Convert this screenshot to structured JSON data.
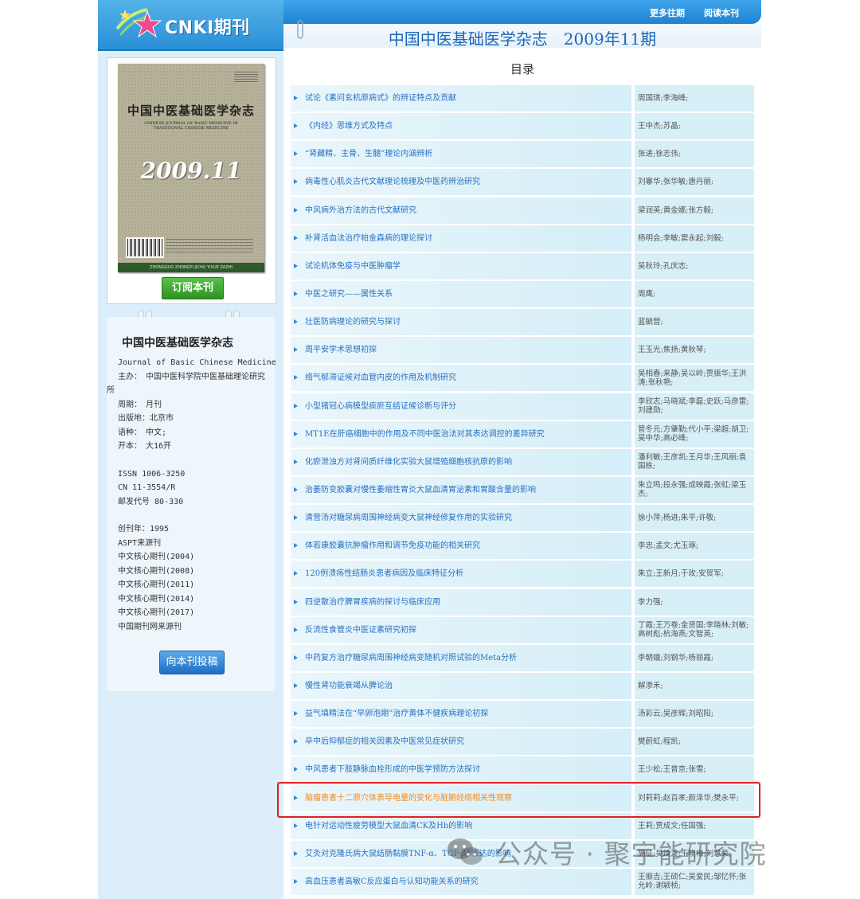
{
  "logo": {
    "text": "CNKI期刊"
  },
  "nav": {
    "more_issues": "更多往期",
    "read_issue": "阅读本刊"
  },
  "header": {
    "journal_issue_title": "中国中医基础医学杂志　2009年11期"
  },
  "toc_heading": "目录",
  "cover": {
    "title": "中国中医基础医学杂志",
    "english": "CHINESE JOURNAL OF BASIC MEDICINE IN TRADITIONAL CHINESE MEDICINE",
    "year_issue": "2009.11",
    "footer": "ZHONGGUO ZHONGYI JICHU YIXUE ZAZHI"
  },
  "subscribe_label": "订阅本刊",
  "journal_info": {
    "name": "中国中医基础医学杂志",
    "lines1": [
      "Journal of Basic Chinese Medicine",
      "主办：　中国中医科学院中医基础理论研究",
      "所",
      "周期：　月刊",
      "出版地：北京市",
      "语种：　中文;",
      "开本：　大16开"
    ],
    "lines2": [
      "ISSN 1006-3250",
      "CN 11-3554/R",
      "邮发代号 80-330"
    ],
    "lines3": [
      "创刊年：1995",
      "ASPT来源刊",
      "中文核心期刊(2004)",
      "中文核心期刊(2008)",
      "中文核心期刊(2011)",
      "中文核心期刊(2014)",
      "中文核心期刊(2017)",
      "中国期刊网来源刊"
    ],
    "submit_label": "向本刊投稿"
  },
  "articles": [
    {
      "title": "试论《素问玄机原病式》的辨证特点及贡献",
      "authors": "周国琪;李海峰;"
    },
    {
      "title": "《内经》思维方式及特点",
      "authors": "王中杰;苏晶;"
    },
    {
      "title": "“肾藏精、主骨、生髓”理论内涵辨析",
      "authors": "张进;徐志伟;"
    },
    {
      "title": "病毒性心肌炎古代文献理论梳理及中医药辨治研究",
      "authors": "刘寨华;张华敏;唐丹丽;"
    },
    {
      "title": "中风病外治方法的古代文献研究",
      "authors": "梁润英;黄金娜;张方毅;"
    },
    {
      "title": "补肾活血法治疗帕金森病的理论探讨",
      "authors": "杨明会;李敏;窦永起;刘毅;"
    },
    {
      "title": "试论机体免疫与中医肿瘤学",
      "authors": "吴秋玲;孔庆志;"
    },
    {
      "title": "中医之研究——属性关系",
      "authors": "周鹰;"
    },
    {
      "title": "壮医防病理论的研究与探讨",
      "authors": "蓝毓营;"
    },
    {
      "title": "周平安学术思想初探",
      "authors": "王玉光;焦扬;黄秋琴;"
    },
    {
      "title": "络气郁滞证候对血管内皮的作用及机制研究",
      "authors": "吴相春;来静;吴以岭;贾振华;王洪涛;张秋艳;"
    },
    {
      "title": "小型猪冠心病模型痰瘀互结证候诊断与评分",
      "authors": "李欣志;马晓斌;李磊;史跃;马彦雷;刘建勋;"
    },
    {
      "title": "MT1E在肝癌细胞中的作用及不同中医治法对其表达调控的差异研究",
      "authors": "管冬元;方肇勤;代小平;梁超;胡卫;吴中华;高必峰;"
    },
    {
      "title": "化瘀泄浊方对肾间质纤维化实验大鼠增殖细胞核抗原的影响",
      "authors": "潘利敏;王彦凯;王月华;王风丽;袁国栋;"
    },
    {
      "title": "治萎防变胶囊对慢性萎缩性胃炎大鼠血清胃泌素和胃酸含量的影响",
      "authors": "朱立鸣;段永强;成映霞;张虹;梁玉杰;"
    },
    {
      "title": "清营汤对糖尿病周围神经病变大鼠神经修复作用的实验研究",
      "authors": "徐小萍;杨进;朱平;许敬;"
    },
    {
      "title": "体若康胶囊抗肿瘤作用和调节免疫功能的相关研究",
      "authors": "李忠;孟文;尤玉琢;"
    },
    {
      "title": "120例溃疡性结肠炎患者病因及临床特征分析",
      "authors": "朱立;王新月;于玫;安贺军;"
    },
    {
      "title": "四逆散治疗脾胃疾病的探讨与临床应用",
      "authors": "李力强;"
    },
    {
      "title": "反流性食管炎中医证素研究初探",
      "authors": "丁霞;王万卷;金贤国;李晓林;刘敏;高树彪;杭海燕;文智英;"
    },
    {
      "title": "中药复方治疗糖尿病周围神经病变随机对照试验的Meta分析",
      "authors": "李朝娥;刘钢华;杨丽霞;"
    },
    {
      "title": "慢性肾功能衰竭从脾论治",
      "authors": "解渗禾;"
    },
    {
      "title": "益气填精法在“早卵泡期”治疗黄体不健疾病理论初探",
      "authors": "汤彩云;吴彦辉;刘昭阳;"
    },
    {
      "title": "卒中后抑郁症的相关因素及中医常见症状研究",
      "authors": "樊蔚虹;程凯;"
    },
    {
      "title": "中风患者下肢静脉血栓形成的中医学预防方法探讨",
      "authors": "王少松;王普京;张雪;"
    },
    {
      "title": "脑瘤患者十二原穴体表导电量的变化与脏腑经络相关性观察",
      "authors": "刘莉莉;赵百孝;颜泽华;樊永平;",
      "highlight": true
    },
    {
      "title": "电针对运动性疲劳模型大鼠血清CK及Hb的影响",
      "authors": "王莉;贾成文;任国强;"
    },
    {
      "title": "艾灸对克隆氏病大鼠结肠黏膜TNF-α、TGF-β1表达的影响",
      "authors": "施征;吴焕淦;王晓梅;刘慧荣;"
    },
    {
      "title": "高血压患者高敏C反应蛋白与认知功能关系的研究",
      "authors": "王振吉;王硕仁;吴爱民;邹忆怀;张允岭;谢颖桢;"
    }
  ],
  "watermark": {
    "text": "公众号 · 聚宇能研究院"
  },
  "colors": {
    "link": "#2671c4",
    "highlight_link": "#f28a1a",
    "highlight_border": "#e02020",
    "left_panel": "#dceefa"
  }
}
